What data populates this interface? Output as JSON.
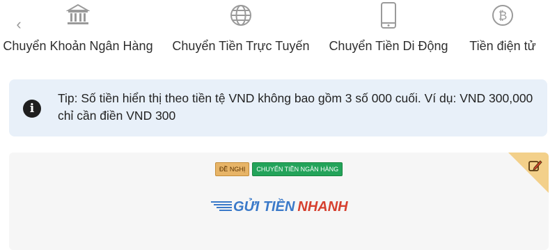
{
  "nav": {
    "back_label": "‹",
    "tabs": [
      {
        "label": "Chuyển Khoản Ngân Hàng",
        "icon": "bank-icon"
      },
      {
        "label": "Chuyển Tiền Trực Tuyến",
        "icon": "globe-icon"
      },
      {
        "label": "Chuyển Tiền Di Động",
        "icon": "mobile-phone-icon"
      },
      {
        "label": "Tiền điện tử",
        "icon": "bitcoin-icon"
      }
    ]
  },
  "tip": {
    "icon": "info-icon",
    "text": "Tip: Số tiền hiển thị theo tiền tệ VND không bao gồm 3 số 000 cuối. Ví dụ: VND 300,000 chỉ cần điền VND 300",
    "background": "#e8f0f9"
  },
  "card": {
    "badges": {
      "suggested": "ĐỀ NGHỊ",
      "method": "CHUYỂN TIỀN NGÂN HÀNG"
    },
    "brand": {
      "part1": "GỬI TIỀN",
      "part2": "NHANH"
    },
    "corner_icon": "edit-icon",
    "colors": {
      "suggested": "#e7b467",
      "method": "#23a35a",
      "brand_blue": "#3a79c9",
      "brand_red": "#d6402f",
      "corner": "#f3d08a"
    }
  }
}
